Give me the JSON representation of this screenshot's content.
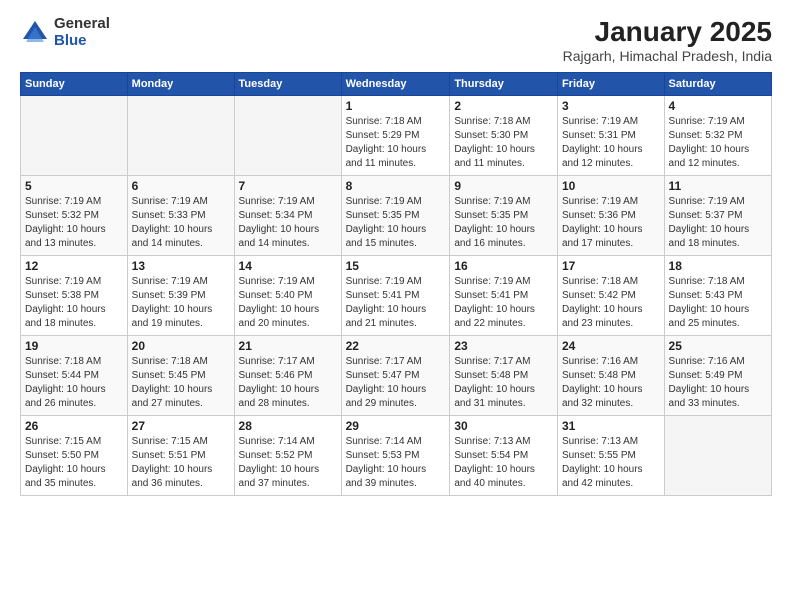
{
  "logo": {
    "general": "General",
    "blue": "Blue"
  },
  "title": {
    "month": "January 2025",
    "location": "Rajgarh, Himachal Pradesh, India"
  },
  "weekdays": [
    "Sunday",
    "Monday",
    "Tuesday",
    "Wednesday",
    "Thursday",
    "Friday",
    "Saturday"
  ],
  "weeks": [
    [
      {
        "day": "",
        "info": ""
      },
      {
        "day": "",
        "info": ""
      },
      {
        "day": "",
        "info": ""
      },
      {
        "day": "1",
        "info": "Sunrise: 7:18 AM\nSunset: 5:29 PM\nDaylight: 10 hours\nand 11 minutes."
      },
      {
        "day": "2",
        "info": "Sunrise: 7:18 AM\nSunset: 5:30 PM\nDaylight: 10 hours\nand 11 minutes."
      },
      {
        "day": "3",
        "info": "Sunrise: 7:19 AM\nSunset: 5:31 PM\nDaylight: 10 hours\nand 12 minutes."
      },
      {
        "day": "4",
        "info": "Sunrise: 7:19 AM\nSunset: 5:32 PM\nDaylight: 10 hours\nand 12 minutes."
      }
    ],
    [
      {
        "day": "5",
        "info": "Sunrise: 7:19 AM\nSunset: 5:32 PM\nDaylight: 10 hours\nand 13 minutes."
      },
      {
        "day": "6",
        "info": "Sunrise: 7:19 AM\nSunset: 5:33 PM\nDaylight: 10 hours\nand 14 minutes."
      },
      {
        "day": "7",
        "info": "Sunrise: 7:19 AM\nSunset: 5:34 PM\nDaylight: 10 hours\nand 14 minutes."
      },
      {
        "day": "8",
        "info": "Sunrise: 7:19 AM\nSunset: 5:35 PM\nDaylight: 10 hours\nand 15 minutes."
      },
      {
        "day": "9",
        "info": "Sunrise: 7:19 AM\nSunset: 5:35 PM\nDaylight: 10 hours\nand 16 minutes."
      },
      {
        "day": "10",
        "info": "Sunrise: 7:19 AM\nSunset: 5:36 PM\nDaylight: 10 hours\nand 17 minutes."
      },
      {
        "day": "11",
        "info": "Sunrise: 7:19 AM\nSunset: 5:37 PM\nDaylight: 10 hours\nand 18 minutes."
      }
    ],
    [
      {
        "day": "12",
        "info": "Sunrise: 7:19 AM\nSunset: 5:38 PM\nDaylight: 10 hours\nand 18 minutes."
      },
      {
        "day": "13",
        "info": "Sunrise: 7:19 AM\nSunset: 5:39 PM\nDaylight: 10 hours\nand 19 minutes."
      },
      {
        "day": "14",
        "info": "Sunrise: 7:19 AM\nSunset: 5:40 PM\nDaylight: 10 hours\nand 20 minutes."
      },
      {
        "day": "15",
        "info": "Sunrise: 7:19 AM\nSunset: 5:41 PM\nDaylight: 10 hours\nand 21 minutes."
      },
      {
        "day": "16",
        "info": "Sunrise: 7:19 AM\nSunset: 5:41 PM\nDaylight: 10 hours\nand 22 minutes."
      },
      {
        "day": "17",
        "info": "Sunrise: 7:18 AM\nSunset: 5:42 PM\nDaylight: 10 hours\nand 23 minutes."
      },
      {
        "day": "18",
        "info": "Sunrise: 7:18 AM\nSunset: 5:43 PM\nDaylight: 10 hours\nand 25 minutes."
      }
    ],
    [
      {
        "day": "19",
        "info": "Sunrise: 7:18 AM\nSunset: 5:44 PM\nDaylight: 10 hours\nand 26 minutes."
      },
      {
        "day": "20",
        "info": "Sunrise: 7:18 AM\nSunset: 5:45 PM\nDaylight: 10 hours\nand 27 minutes."
      },
      {
        "day": "21",
        "info": "Sunrise: 7:17 AM\nSunset: 5:46 PM\nDaylight: 10 hours\nand 28 minutes."
      },
      {
        "day": "22",
        "info": "Sunrise: 7:17 AM\nSunset: 5:47 PM\nDaylight: 10 hours\nand 29 minutes."
      },
      {
        "day": "23",
        "info": "Sunrise: 7:17 AM\nSunset: 5:48 PM\nDaylight: 10 hours\nand 31 minutes."
      },
      {
        "day": "24",
        "info": "Sunrise: 7:16 AM\nSunset: 5:48 PM\nDaylight: 10 hours\nand 32 minutes."
      },
      {
        "day": "25",
        "info": "Sunrise: 7:16 AM\nSunset: 5:49 PM\nDaylight: 10 hours\nand 33 minutes."
      }
    ],
    [
      {
        "day": "26",
        "info": "Sunrise: 7:15 AM\nSunset: 5:50 PM\nDaylight: 10 hours\nand 35 minutes."
      },
      {
        "day": "27",
        "info": "Sunrise: 7:15 AM\nSunset: 5:51 PM\nDaylight: 10 hours\nand 36 minutes."
      },
      {
        "day": "28",
        "info": "Sunrise: 7:14 AM\nSunset: 5:52 PM\nDaylight: 10 hours\nand 37 minutes."
      },
      {
        "day": "29",
        "info": "Sunrise: 7:14 AM\nSunset: 5:53 PM\nDaylight: 10 hours\nand 39 minutes."
      },
      {
        "day": "30",
        "info": "Sunrise: 7:13 AM\nSunset: 5:54 PM\nDaylight: 10 hours\nand 40 minutes."
      },
      {
        "day": "31",
        "info": "Sunrise: 7:13 AM\nSunset: 5:55 PM\nDaylight: 10 hours\nand 42 minutes."
      },
      {
        "day": "",
        "info": ""
      }
    ]
  ]
}
